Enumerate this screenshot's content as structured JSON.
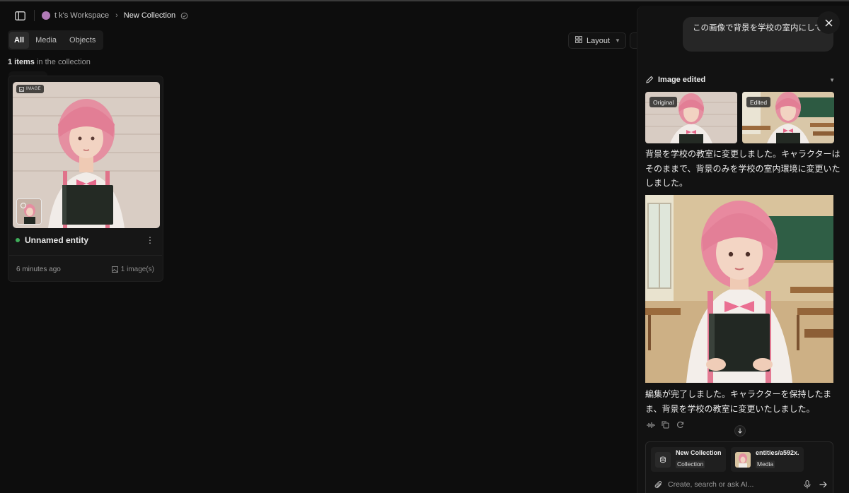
{
  "header": {
    "workspace_name": "t k's Workspace",
    "collection_name": "New Collection"
  },
  "toolbar": {
    "tabs": [
      {
        "label": "All",
        "active": true
      },
      {
        "label": "Media",
        "active": false
      },
      {
        "label": "Objects",
        "active": false
      }
    ],
    "layout_label": "Layout",
    "items_count": "1 items",
    "items_suffix": "in the collection"
  },
  "card": {
    "badge": "IMAGE",
    "title": "Unnamed entity",
    "time": "6 minutes ago",
    "image_count": "1 image(s)",
    "status_color": "#3fae5a"
  },
  "chat": {
    "user_message": "この画像で背景を学校の室内にして",
    "edit_title": "Image edited",
    "original_label": "Original",
    "edited_label": "Edited",
    "response_1": "背景を学校の教室に変更しました。キャラクターはそのままで、背景のみを学校の室内環境に変更いたしました。",
    "response_2": "編集が完了しました。キャラクターを保持したまま、背景を学校の教室に変更いたしました。",
    "chips": [
      {
        "title": "New Collection",
        "tag": "Collection"
      },
      {
        "title": "entities/a592x.",
        "tag": "Media"
      }
    ],
    "composer_placeholder": "Create, search or ask AI..."
  },
  "colors": {
    "background": "#0d0d0d",
    "panel": "#121212",
    "workspace_dot": "#b07ab6",
    "status_green": "#3fae5a"
  }
}
